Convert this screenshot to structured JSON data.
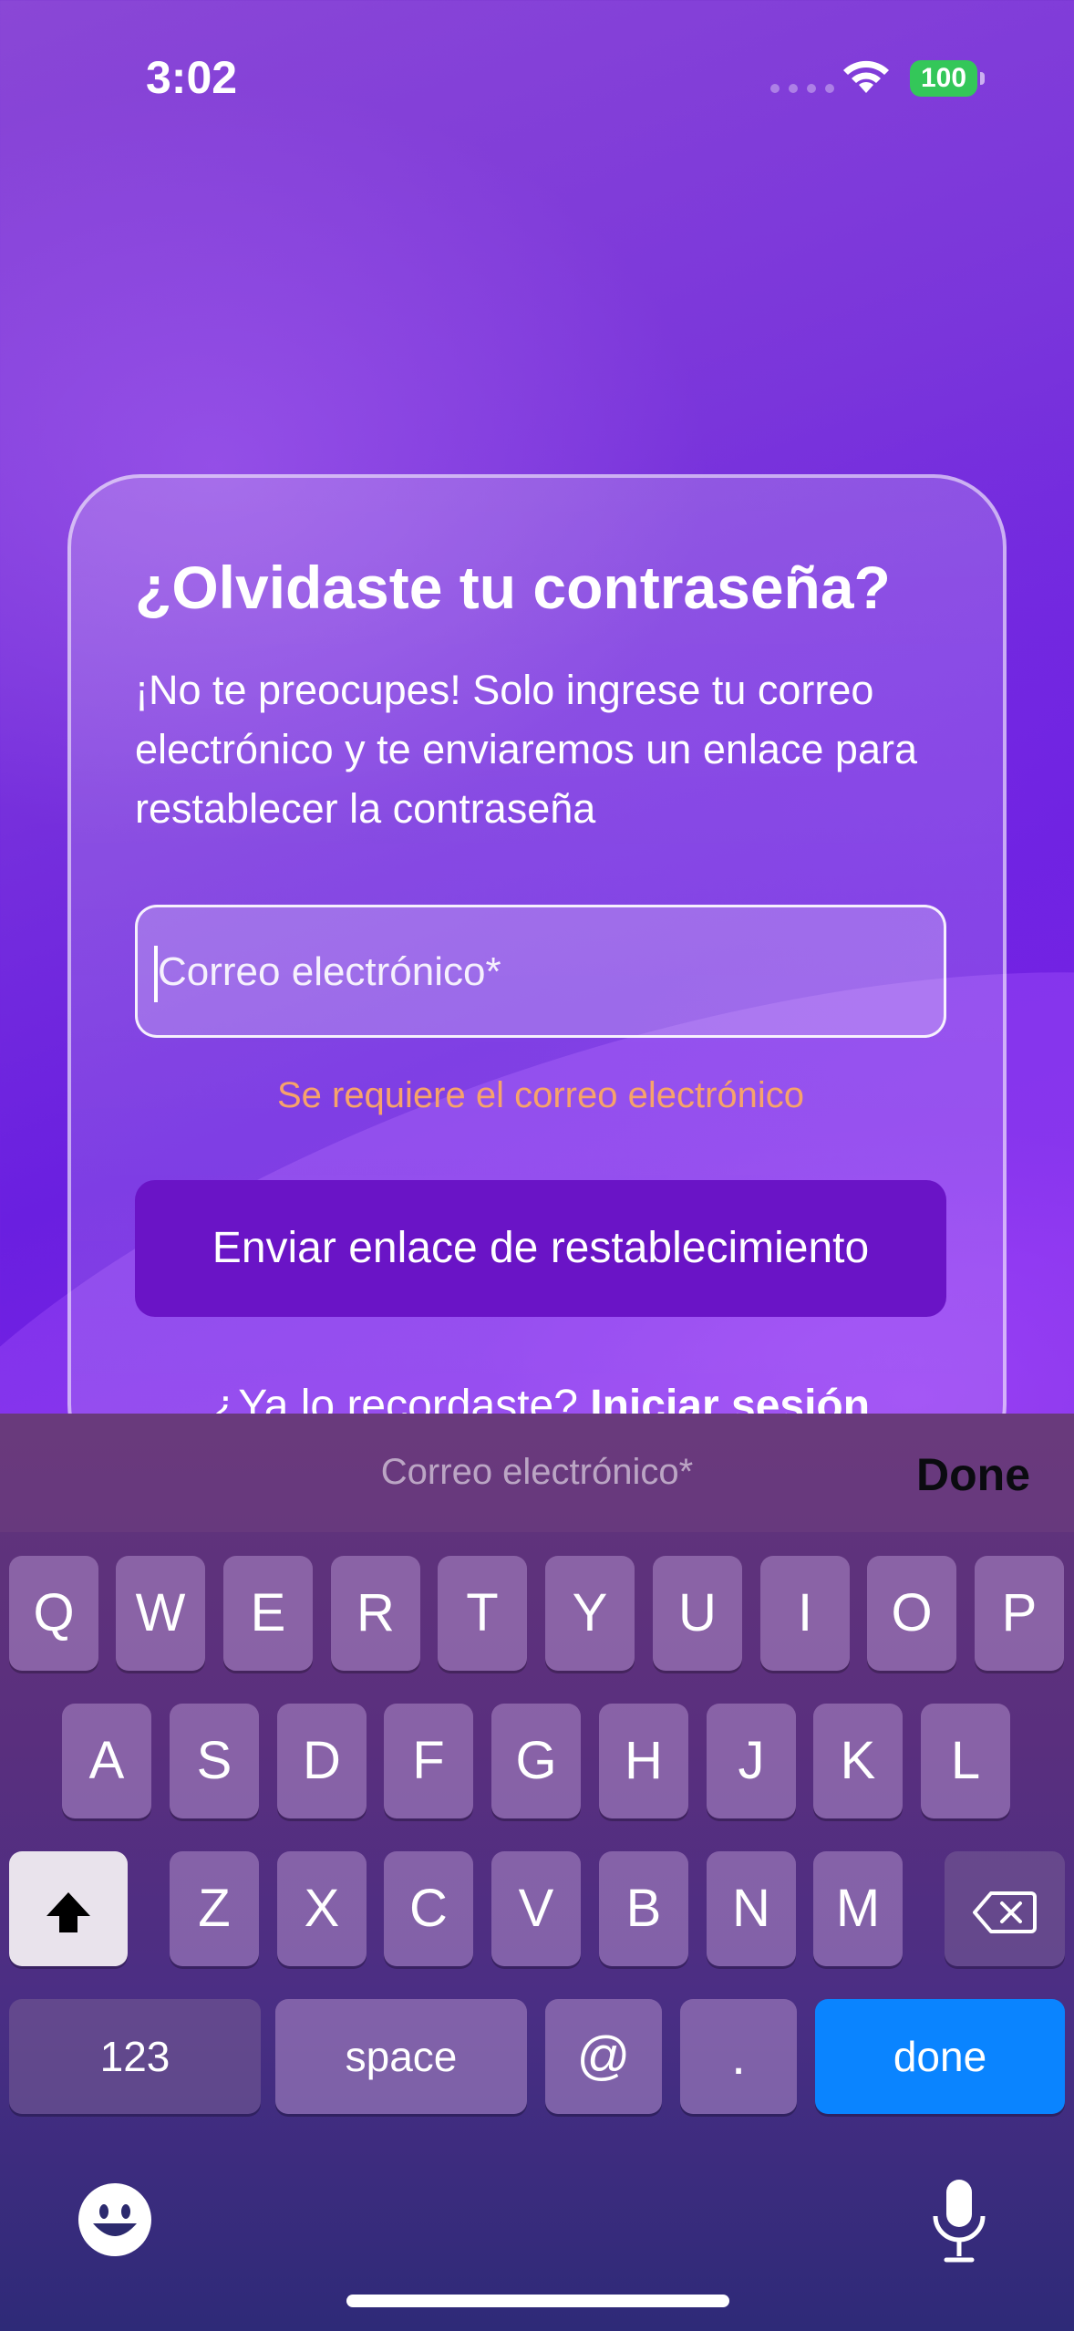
{
  "status_bar": {
    "time": "3:02",
    "battery": "100"
  },
  "card": {
    "title": "¿Olvidaste tu contraseña?",
    "description": "¡No te preocupes! Solo ingrese tu correo electrónico y te enviaremos un enlace para restablecer la contraseña",
    "email_placeholder": "Correo electrónico*",
    "error_text": "Se requiere el correo electrónico",
    "submit_label": "Enviar enlace de restablecimiento",
    "login_prompt": "¿Ya lo recordaste?",
    "login_link": "Iniciar sesión"
  },
  "keyboard": {
    "toolbar_label": "Correo electrónico*",
    "toolbar_done": "Done",
    "row1": [
      "Q",
      "W",
      "E",
      "R",
      "T",
      "Y",
      "U",
      "I",
      "O",
      "P"
    ],
    "row2": [
      "A",
      "S",
      "D",
      "F",
      "G",
      "H",
      "J",
      "K",
      "L"
    ],
    "row3": [
      "Z",
      "X",
      "C",
      "V",
      "B",
      "N",
      "M"
    ],
    "numbers_label": "123",
    "space_label": "space",
    "at_label": "@",
    "dot_label": ".",
    "done_label": "done",
    "icons": {
      "shift": "shift-icon",
      "backspace": "backspace-icon",
      "emoji": "emoji-icon",
      "mic": "microphone-icon"
    }
  },
  "colors": {
    "accent_button": "#6a14c6",
    "error": "#f7a36a",
    "keyboard_done": "#0a84ff",
    "battery": "#34c759"
  }
}
